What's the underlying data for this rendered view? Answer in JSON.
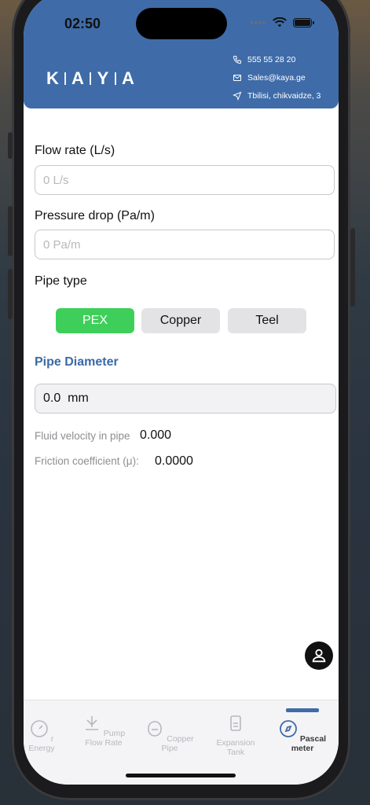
{
  "status": {
    "time": "02:50"
  },
  "header": {
    "logo": [
      "K",
      "A",
      "Y",
      "A"
    ],
    "phone": "555 55 28 20",
    "email": "Sales@kaya.ge",
    "address": "Tbilisi, chikvaidze, 3"
  },
  "form": {
    "flow_label": "Flow rate (L/s)",
    "flow_placeholder": "0 L/s",
    "pressure_label": "Pressure drop (Pa/m)",
    "pressure_placeholder": "0 Pa/m",
    "pipe_type_label": "Pipe type",
    "pipe_types": [
      "PEX",
      "Copper",
      "Teel"
    ],
    "selected_pipe_type": "PEX",
    "diameter_title": "Pipe Diameter",
    "diameter_value": "0.0  mm"
  },
  "results": {
    "velocity_label": "Fluid velocity in pipe",
    "velocity_value": "0.000",
    "friction_label": "Friction coefficient (μ):",
    "friction_value": "0.0000"
  },
  "tabs": [
    {
      "label": "r Energy",
      "icon": "gauge-icon"
    },
    {
      "label": "Pump\nFlow Rate",
      "icon": "pump-icon"
    },
    {
      "label": "Copper Pipe",
      "icon": "pipe-icon"
    },
    {
      "label": "Expansion\nTank",
      "icon": "tank-icon"
    },
    {
      "label": "Pascal meter",
      "icon": "compass-icon",
      "active": true
    }
  ],
  "colors": {
    "brand": "#3f6ca8",
    "active_segment": "#3ecf5a"
  }
}
